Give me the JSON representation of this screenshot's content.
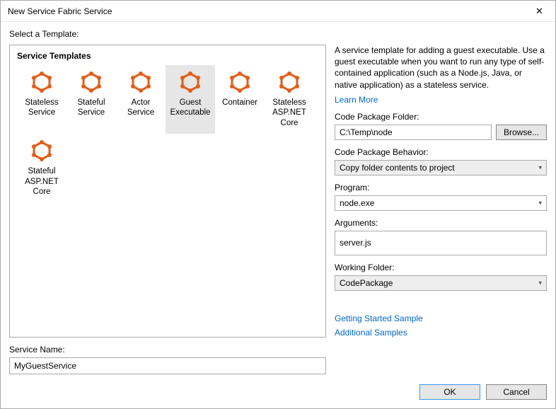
{
  "window": {
    "title": "New Service Fabric Service"
  },
  "prompt": "Select a Template:",
  "templates": {
    "header": "Service Templates",
    "items": [
      {
        "label": "Stateless\nService",
        "name": "template-stateless-service"
      },
      {
        "label": "Stateful\nService",
        "name": "template-stateful-service"
      },
      {
        "label": "Actor Service",
        "name": "template-actor-service"
      },
      {
        "label": "Guest\nExecutable",
        "name": "template-guest-executable",
        "selected": true
      },
      {
        "label": "Container",
        "name": "template-container"
      },
      {
        "label": "Stateless\nASP.NET\nCore",
        "name": "template-stateless-aspnet-core"
      },
      {
        "label": "Stateful\nASP.NET\nCore",
        "name": "template-stateful-aspnet-core"
      }
    ]
  },
  "right": {
    "description": "A service template for adding a guest executable. Use a guest executable when you want to run any type of self-contained application (such as a Node.js, Java, or native application) as a stateless service.",
    "learn_more": "Learn More",
    "code_package_folder_label": "Code Package Folder:",
    "code_package_folder_value": "C:\\Temp\\node",
    "browse_label": "Browse...",
    "behavior_label": "Code Package Behavior:",
    "behavior_value": "Copy folder contents to project",
    "program_label": "Program:",
    "program_value": "node.exe",
    "arguments_label": "Arguments:",
    "arguments_value": "server.js",
    "working_folder_label": "Working Folder:",
    "working_folder_value": "CodePackage",
    "sample_link": "Getting Started Sample",
    "additional_link": "Additional Samples"
  },
  "service_name_label": "Service Name:",
  "service_name_value": "MyGuestService",
  "footer": {
    "ok": "OK",
    "cancel": "Cancel"
  }
}
